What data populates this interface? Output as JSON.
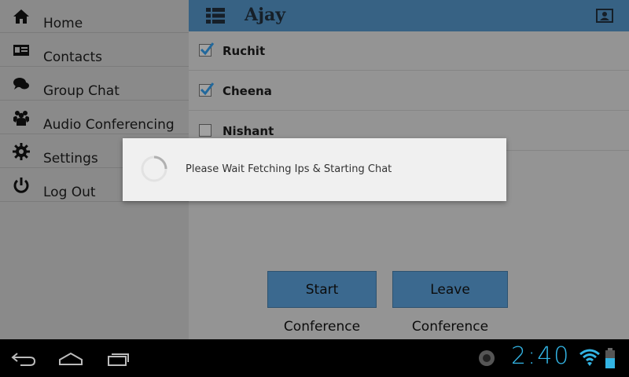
{
  "sidebar": {
    "items": [
      {
        "label": "Home",
        "icon": "home-icon"
      },
      {
        "label": "Contacts",
        "icon": "contacts-icon"
      },
      {
        "label": "Group Chat",
        "icon": "chat-bubbles-icon"
      },
      {
        "label": "Audio Conferencing",
        "icon": "people-icon"
      },
      {
        "label": "Settings",
        "icon": "gear-icon"
      },
      {
        "label": "Log Out",
        "icon": "power-icon"
      }
    ]
  },
  "header": {
    "title": "Ajay"
  },
  "participants": [
    {
      "name": "Ruchit",
      "checked": true
    },
    {
      "name": "Cheena",
      "checked": true
    },
    {
      "name": "Nishant",
      "checked": false
    }
  ],
  "actions": {
    "start_label": "Start Conference",
    "leave_label": "Leave Conference"
  },
  "dialog": {
    "message": "Please Wait Fetching Ips & Starting Chat"
  },
  "system_bar": {
    "time": "2:40"
  },
  "colors": {
    "accent": "#4a83b0",
    "button": "#4f8dbf",
    "clock": "#33b5e5",
    "check": "#2c8bd0"
  }
}
